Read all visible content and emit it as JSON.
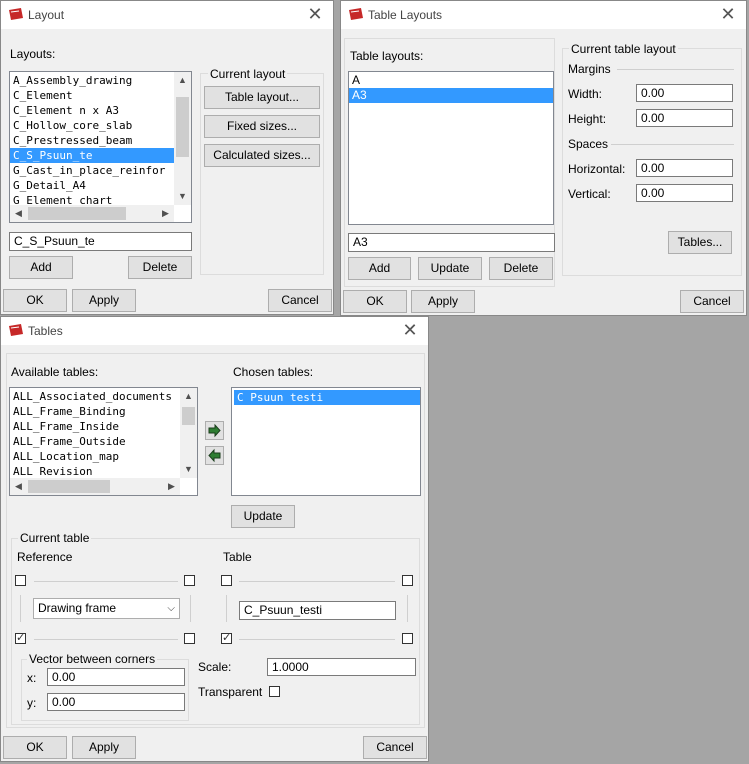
{
  "layout_dialog": {
    "title": "Layout",
    "layouts_label": "Layouts:",
    "layouts": [
      "A_Assembly_drawing",
      "C_Element",
      "C_Element n x A3",
      "C_Hollow_core_slab",
      "C_Prestressed_beam",
      "C_S_Psuun_te",
      "G_Cast_in_place_reinfor",
      "G_Detail_A4",
      "G_Element chart"
    ],
    "selected_layout_index": 5,
    "current_group_label": "Current layout",
    "table_layout_button": "Table layout...",
    "fixed_sizes_button": "Fixed sizes...",
    "calculated_sizes_button": "Calculated sizes...",
    "name_value": "C_S_Psuun_te",
    "add_button": "Add",
    "delete_button": "Delete",
    "ok_button": "OK",
    "apply_button": "Apply",
    "cancel_button": "Cancel"
  },
  "table_layouts_dialog": {
    "title": "Table Layouts",
    "table_layouts_label": "Table layouts:",
    "table_layouts": [
      "A",
      "A3"
    ],
    "selected_index": 1,
    "current_group_label": "Current table layout",
    "margins_label": "Margins",
    "width_label": "Width:",
    "width_value": "0.00",
    "height_label": "Height:",
    "height_value": "0.00",
    "spaces_label": "Spaces",
    "horizontal_label": "Horizontal:",
    "horizontal_value": "0.00",
    "vertical_label": "Vertical:",
    "vertical_value": "0.00",
    "tables_button": "Tables...",
    "name_value": "A3",
    "add_button": "Add",
    "update_button": "Update",
    "delete_button": "Delete",
    "ok_button": "OK",
    "apply_button": "Apply",
    "cancel_button": "Cancel"
  },
  "tables_dialog": {
    "title": "Tables",
    "available_label": "Available tables:",
    "available_tables": [
      "ALL_Associated_documents",
      "ALL_Frame_Binding",
      "ALL_Frame_Inside",
      "ALL_Frame_Outside",
      "ALL_Location_map",
      "ALL Revision"
    ],
    "chosen_label": "Chosen tables:",
    "chosen_tables": [
      "C Psuun testi"
    ],
    "update_button": "Update",
    "current_table_label": "Current table",
    "reference_label": "Reference",
    "reference_value": "Drawing frame",
    "table_label": "Table",
    "table_value": "C_Psuun_testi",
    "vector_label": "Vector between corners",
    "x_label": "x:",
    "x_value": "0.00",
    "y_label": "y:",
    "y_value": "0.00",
    "scale_label": "Scale:",
    "scale_value": "1.0000",
    "transparent_label": "Transparent",
    "ok_button": "OK",
    "apply_button": "Apply",
    "cancel_button": "Cancel"
  },
  "icons": {
    "check": "✓",
    "close": "✕"
  },
  "colors": {
    "selection": "#3399ff",
    "app_icon": "#c62828"
  }
}
